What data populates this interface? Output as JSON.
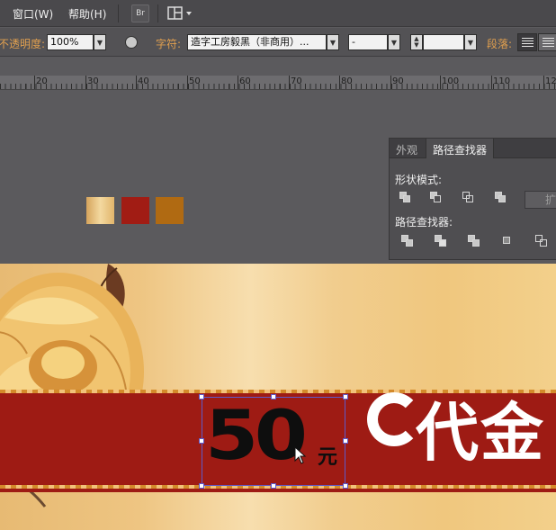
{
  "menubar": {
    "items": [
      "窗口(W)",
      "帮助(H)"
    ],
    "bridge_button": "Br",
    "arrange_button": "workspace-layout-icon"
  },
  "control_bar": {
    "opacity_label": "不透明度:",
    "opacity_value": "100%",
    "character_label": "字符:",
    "font_value": "造字工房毅黑（非商用）...",
    "font_style_value": "-",
    "font_size_value": "",
    "paragraph_label": "段落:"
  },
  "ruler": {
    "labels": [
      "20",
      "30",
      "40",
      "50",
      "60",
      "70",
      "80",
      "90",
      "100",
      "110",
      "12"
    ]
  },
  "swatches": [
    {
      "name": "gold-gradient",
      "color": "#e8c27e"
    },
    {
      "name": "dark-red",
      "color": "#a11c14"
    },
    {
      "name": "brown-orange",
      "color": "#b06a12"
    }
  ],
  "pathfinder_panel": {
    "tabs": [
      "外观",
      "路径查找器"
    ],
    "active_tab": "路径查找器",
    "shape_modes_label": "形状模式:",
    "pathfinders_label": "路径查找器:",
    "expand_button": "扩"
  },
  "artwork": {
    "price_number": "50",
    "price_unit": "元",
    "coupon_text": "代金"
  },
  "colors": {
    "accent_label": "#e2a04f",
    "band_red": "#9e1b14",
    "selection": "#5f59c8"
  }
}
